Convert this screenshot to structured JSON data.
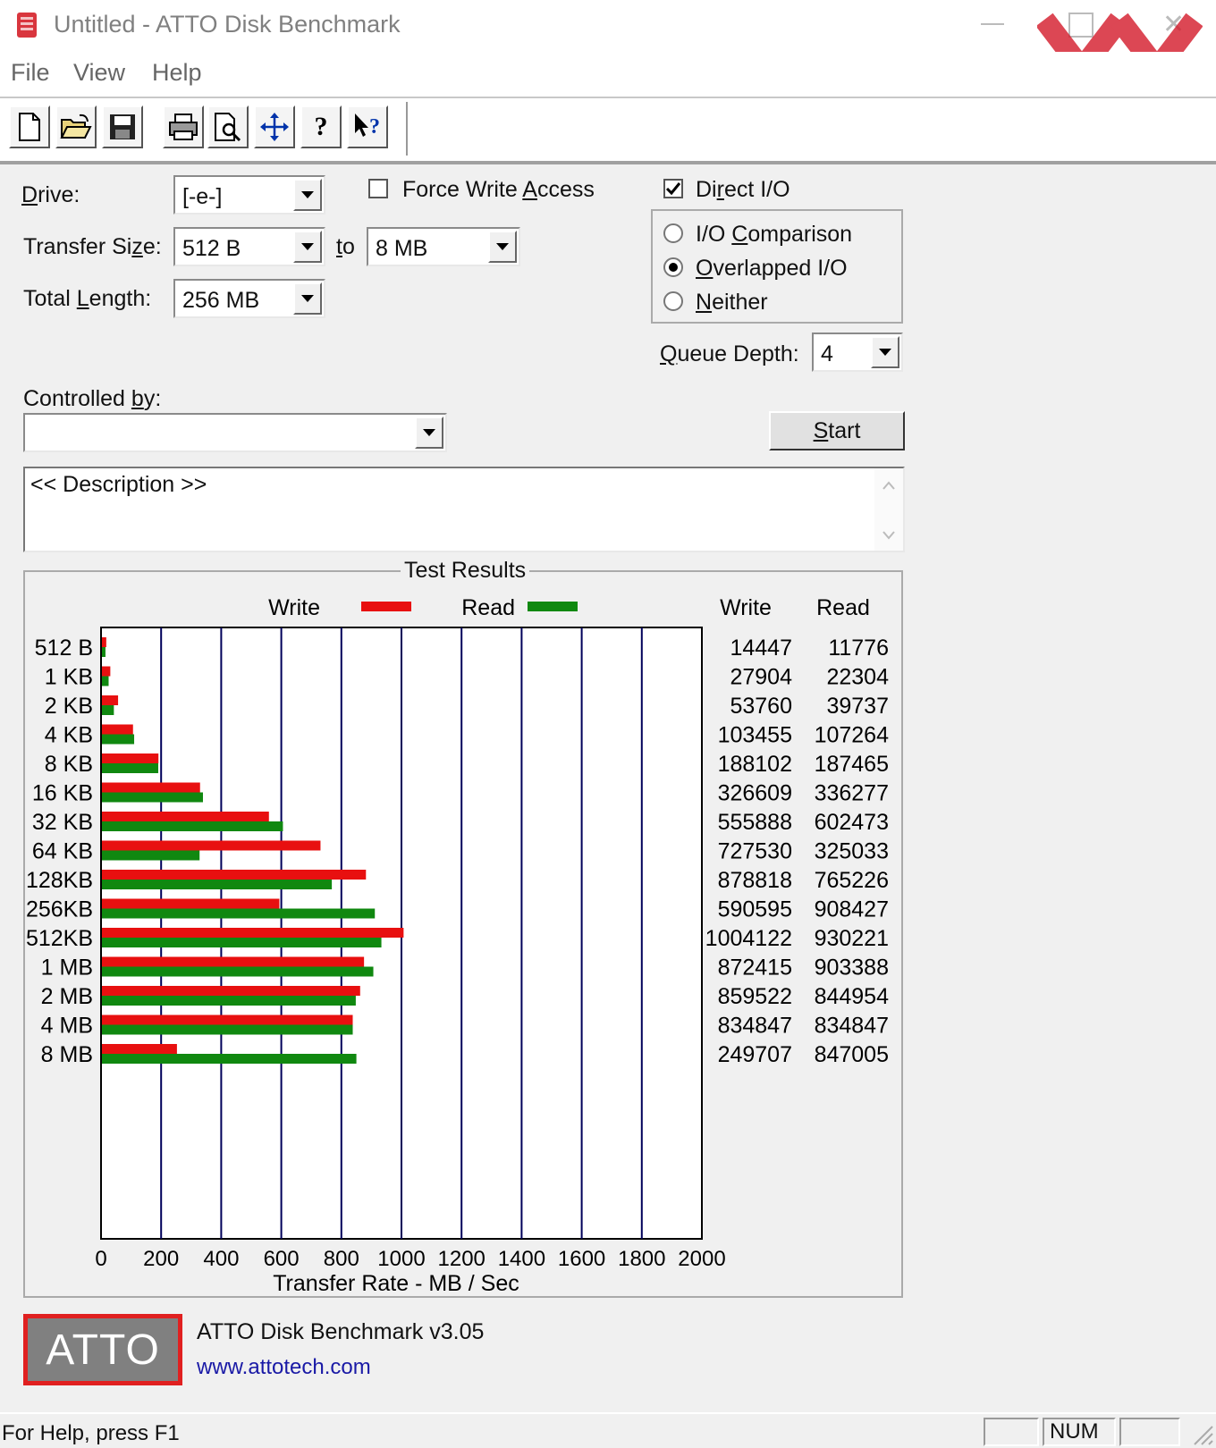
{
  "window": {
    "title": "Untitled - ATTO Disk Benchmark",
    "close_glyph": "✕"
  },
  "menu": [
    "File",
    "View",
    "Help"
  ],
  "toolbar": [
    "new-file-icon",
    "open-folder-icon",
    "save-icon",
    "print-icon",
    "print-preview-icon",
    "move-icon",
    "help-icon",
    "context-help-icon"
  ],
  "form": {
    "drive_label": "Drive:",
    "drive_value": "[-e-]",
    "force_write_label": "Force Write Access",
    "force_write_checked": false,
    "direct_io_label": "Direct I/O",
    "direct_io_checked": true,
    "transfer_size_label": "Transfer Size:",
    "transfer_size_from": "512 B",
    "to_label": "to",
    "transfer_size_to": "8 MB",
    "total_length_label": "Total Length:",
    "total_length_value": "256 MB",
    "io_options": [
      {
        "label": "I/O Comparison",
        "selected": false
      },
      {
        "label": "Overlapped I/O",
        "selected": true
      },
      {
        "label": "Neither",
        "selected": false
      }
    ],
    "queue_depth_label": "Queue Depth:",
    "queue_depth_value": "4",
    "controlled_by_label": "Controlled by:",
    "controlled_by_value": "",
    "start_label": "Start",
    "description": "<< Description >>"
  },
  "results": {
    "group_title": "Test Results",
    "write_header": "Write",
    "read_header": "Read"
  },
  "chart_data": {
    "type": "bar",
    "orientation": "horizontal",
    "categories": [
      "512 B",
      "1 KB",
      "2 KB",
      "4 KB",
      "8 KB",
      "16 KB",
      "32 KB",
      "64 KB",
      "128KB",
      "256KB",
      "512KB",
      "1 MB",
      "2 MB",
      "4 MB",
      "8 MB"
    ],
    "series": [
      {
        "name": "Write",
        "color": "#e81010",
        "values": [
          14447,
          27904,
          53760,
          103455,
          188102,
          326609,
          555888,
          727530,
          878818,
          590595,
          1004122,
          872415,
          859522,
          834847,
          249707
        ]
      },
      {
        "name": "Read",
        "color": "#108810",
        "values": [
          11776,
          22304,
          39737,
          107264,
          187465,
          336277,
          602473,
          325033,
          765226,
          908427,
          930221,
          903388,
          844954,
          834847,
          847005
        ]
      }
    ],
    "xlabel": "Transfer Rate - MB / Sec",
    "xticks": [
      "0",
      "200",
      "400",
      "600",
      "800",
      "1000",
      "1200",
      "1400",
      "1600",
      "1800",
      "2000"
    ],
    "xlim": [
      0,
      2000
    ],
    "grid": true,
    "legend": "top"
  },
  "footer": {
    "logo_text": "ATTO",
    "product": "ATTO Disk Benchmark v3.05",
    "url": "www.attotech.com"
  },
  "status": {
    "help": "For Help, press F1",
    "num": "NUM"
  }
}
